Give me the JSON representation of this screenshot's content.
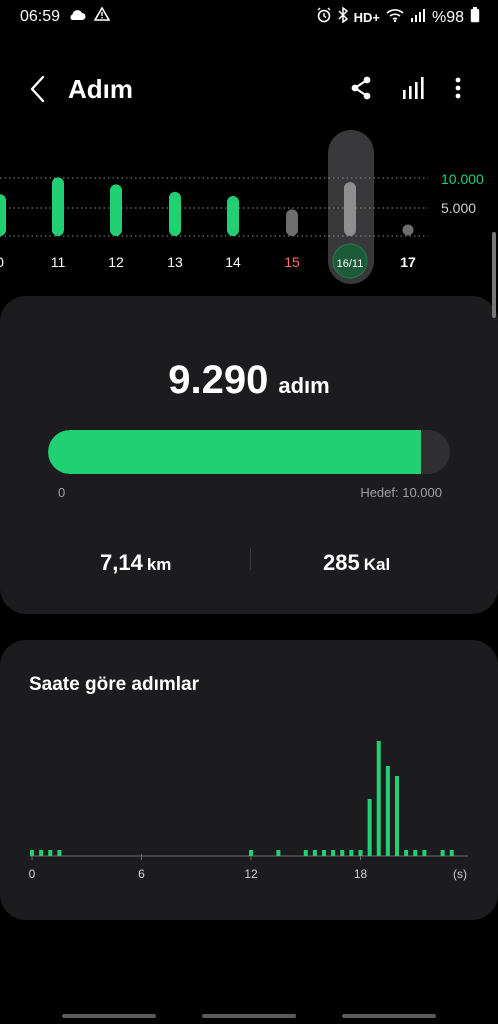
{
  "status": {
    "time": "06:59",
    "network": "HD+",
    "battery": "%98"
  },
  "header": {
    "title": "Adım"
  },
  "week": {
    "goal_lines": [
      "10.000",
      "5.000"
    ],
    "days": [
      {
        "label": "0",
        "value": 7200,
        "state": "past"
      },
      {
        "label": "11",
        "value": 10100,
        "state": "past"
      },
      {
        "label": "12",
        "value": 8900,
        "state": "past"
      },
      {
        "label": "13",
        "value": 7600,
        "state": "past"
      },
      {
        "label": "14",
        "value": 6900,
        "state": "past"
      },
      {
        "label": "15",
        "value": 4600,
        "state": "below"
      },
      {
        "label": "16/11",
        "value": 9290,
        "state": "selected"
      },
      {
        "label": "17",
        "value": 0,
        "state": "future"
      }
    ]
  },
  "summary": {
    "steps": "9.290",
    "steps_unit": "adım",
    "progress_min": "0",
    "goal_label": "Hedef: 10.000",
    "progress_fraction": 0.929,
    "distance_value": "7,14",
    "distance_unit": "km",
    "calories_value": "285",
    "calories_unit": "Kal"
  },
  "hourly": {
    "title": "Saate göre adımlar",
    "x_labels": [
      "0",
      "6",
      "12",
      "18"
    ],
    "x_unit": "(s)",
    "colors": {
      "bar": "#21d073",
      "axis": "#6b6b6b"
    }
  },
  "chart_data": {
    "type": "bar",
    "title": "Saate göre adımlar",
    "xlabel": "(s)",
    "ylabel": "",
    "x_ticks": [
      "0",
      "6",
      "12",
      "18"
    ],
    "x": [
      0,
      0.5,
      1,
      1.5,
      12,
      13.5,
      15,
      15.5,
      16,
      16.5,
      17,
      17.5,
      18,
      18.5,
      19,
      19.5,
      20,
      20.5,
      21,
      21.5,
      22.5,
      23
    ],
    "values": [
      60,
      60,
      60,
      60,
      60,
      60,
      60,
      60,
      60,
      60,
      60,
      60,
      60,
      570,
      1150,
      900,
      800,
      60,
      60,
      60,
      60,
      60
    ]
  },
  "colors": {
    "accent": "#21d073",
    "weekend": "#ff6b6b",
    "card": "#1c1c1e"
  }
}
